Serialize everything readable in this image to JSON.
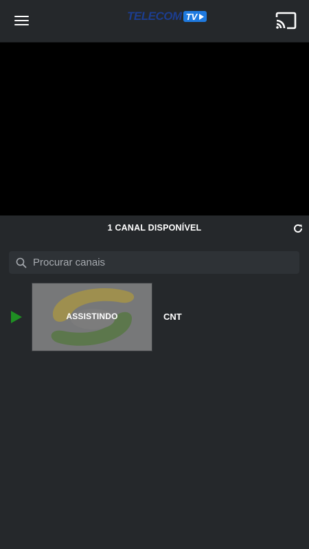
{
  "header": {
    "logo_text": "TELECOM",
    "logo_badge": "TV"
  },
  "channels": {
    "count_label": "1 CANAL DISPONÍVEL",
    "search_placeholder": "Procurar canais",
    "search_value": "",
    "items": [
      {
        "name": "CNT",
        "status": "ASSISTINDO"
      }
    ]
  },
  "colors": {
    "background": "#25282b",
    "player": "#000000",
    "accent_green": "#1f8f23",
    "logo_blue": "#1c3d8f",
    "logo_badge": "#1f7ae0"
  },
  "icons": {
    "menu": "hamburger-menu-icon",
    "cast": "cast-icon",
    "refresh": "refresh-icon",
    "search": "search-icon",
    "play": "play-icon"
  }
}
